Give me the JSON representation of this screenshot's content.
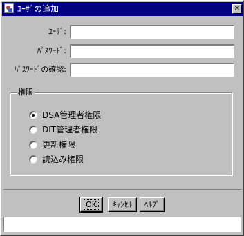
{
  "window": {
    "title": "ﾕｰｻﾞの追加",
    "close_glyph": "✕"
  },
  "form": {
    "user_label": "ﾕｰｻﾞ:",
    "user_value": "",
    "password_label": "ﾊﾟｽﾜｰﾄﾞ:",
    "password_value": "",
    "password_confirm_label": "ﾊﾟｽﾜｰﾄﾞの確認:",
    "password_confirm_value": ""
  },
  "permissions": {
    "legend": "権限",
    "options": [
      {
        "label": "DSA管理者権限",
        "checked": true
      },
      {
        "label": "DIT管理者権限",
        "checked": false
      },
      {
        "label": "更新権限",
        "checked": false
      },
      {
        "label": "読込み権限",
        "checked": false
      }
    ]
  },
  "buttons": {
    "ok": "OK",
    "cancel": "ｷｬﾝｾﾙ",
    "help": "ﾍﾙﾌﾟ"
  },
  "status": {
    "text": ""
  }
}
